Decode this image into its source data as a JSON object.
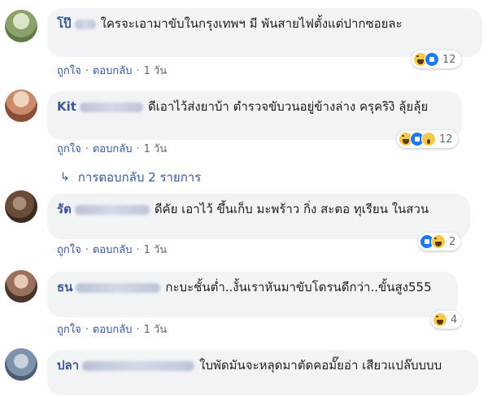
{
  "colors": {
    "link": "#385898",
    "bubble": "#f2f3f5",
    "meta": "#606770"
  },
  "comments": [
    {
      "author": "โป๊",
      "text": "ใครจะเอามาขับในกรุงเทพฯ มี พันสายไฟตั้งแต่ปากซอยละ",
      "actions": {
        "like": "ถูกใจ",
        "reply": "ตอบกลับ",
        "time": "1 วัน"
      },
      "reactions": {
        "icons": [
          "haha-icon",
          "like-icon"
        ],
        "count": "12"
      }
    },
    {
      "author": "Kit",
      "text": "ดีเอาไว้ส่งยาบ้า ตำรวจขับวนอยู่ข้างล่าง ครุคริงิ ลุ้ยลุ้ย",
      "actions": {
        "like": "ถูกใจ",
        "reply": "ตอบกลับ",
        "time": "1 วัน"
      },
      "reactions": {
        "icons": [
          "haha-icon",
          "like-icon",
          "wow-icon"
        ],
        "count": "12"
      },
      "replies": "การตอบกลับ 2 รายการ"
    },
    {
      "author": "รัต",
      "text": "ดีคัย เอาไว้ ขึ้นเก็บ มะพร้าว กิ่ง สะตอ ทุเรียน ในสวน",
      "actions": {
        "like": "ถูกใจ",
        "reply": "ตอบกลับ",
        "time": "1 วัน"
      },
      "reactions": {
        "icons": [
          "like-icon",
          "haha-icon"
        ],
        "count": "2"
      }
    },
    {
      "author": "ธน",
      "text": "กะบะชั้นต่ำ..งั้นเราหันมาขับโดรนดีกว่า..ขั้นสูง555",
      "actions": {
        "like": "ถูกใจ",
        "reply": "ตอบกลับ",
        "time": "1 วัน"
      },
      "reactions": {
        "icons": [
          "haha-icon"
        ],
        "count": "4"
      }
    },
    {
      "author": "ปลา",
      "text": "ใบพัดมันจะหลุดมาตัดคอมั๊ยอ่า เสียวแปล๊บบบบ"
    }
  ]
}
